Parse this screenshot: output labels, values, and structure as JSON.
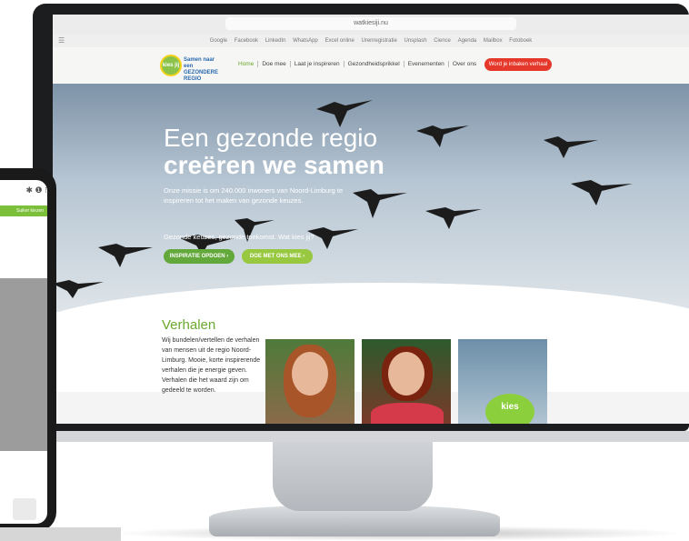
{
  "browser": {
    "url": "watkiesiji.nu",
    "bookmarks": [
      "Google",
      "Facebook",
      "LinkedIn",
      "WhatsApp",
      "Excel online",
      "Urenregistratie",
      "Unsplash",
      "Cience",
      "Agenda",
      "Mailbox",
      "Fotoboek"
    ]
  },
  "site": {
    "logo_badge": "kies jij",
    "logo_text_line1": "Samen naar een",
    "logo_text_line2": "GEZONDERE",
    "logo_text_line3": "REGIO",
    "nav": [
      "Home",
      "Doe mee",
      "Laat je inspireren",
      "Gezondheidsprikkel",
      "Evenementen",
      "Over ons"
    ],
    "cta": "Word je inbaken verhaal"
  },
  "hero": {
    "title_line1": "Een gezonde regio",
    "title_line2": "creëren we samen",
    "body": "Onze missie is om 240.000 inwoners van Noord-Limburg te inspireren tot het maken van gezonde keuzes.",
    "tagline": "Gezonde keuzes, gezonde toekomst. Wat kies jij?",
    "button_primary": "INSPIRATIE OPDOEN ›",
    "button_secondary": "DOE MET ONS MEE ›"
  },
  "verhalen": {
    "title": "Verhalen",
    "body": "Wij bundelen/vertellen de verhalen van mensen uit de regio Noord-Limburg. Mooie, korte inspirerende verhalen die je energie geven. Verhalen die het waard zijn om gedeeld te worden.",
    "card3_badge": "kies"
  },
  "phone": {
    "top_icons": "✱ ❶ ⁝",
    "green_bar": "Suiker kiezen"
  },
  "colors": {
    "brand_green": "#6aa82e",
    "cta_red": "#e5382b",
    "bezel": "#1b1d1f"
  }
}
